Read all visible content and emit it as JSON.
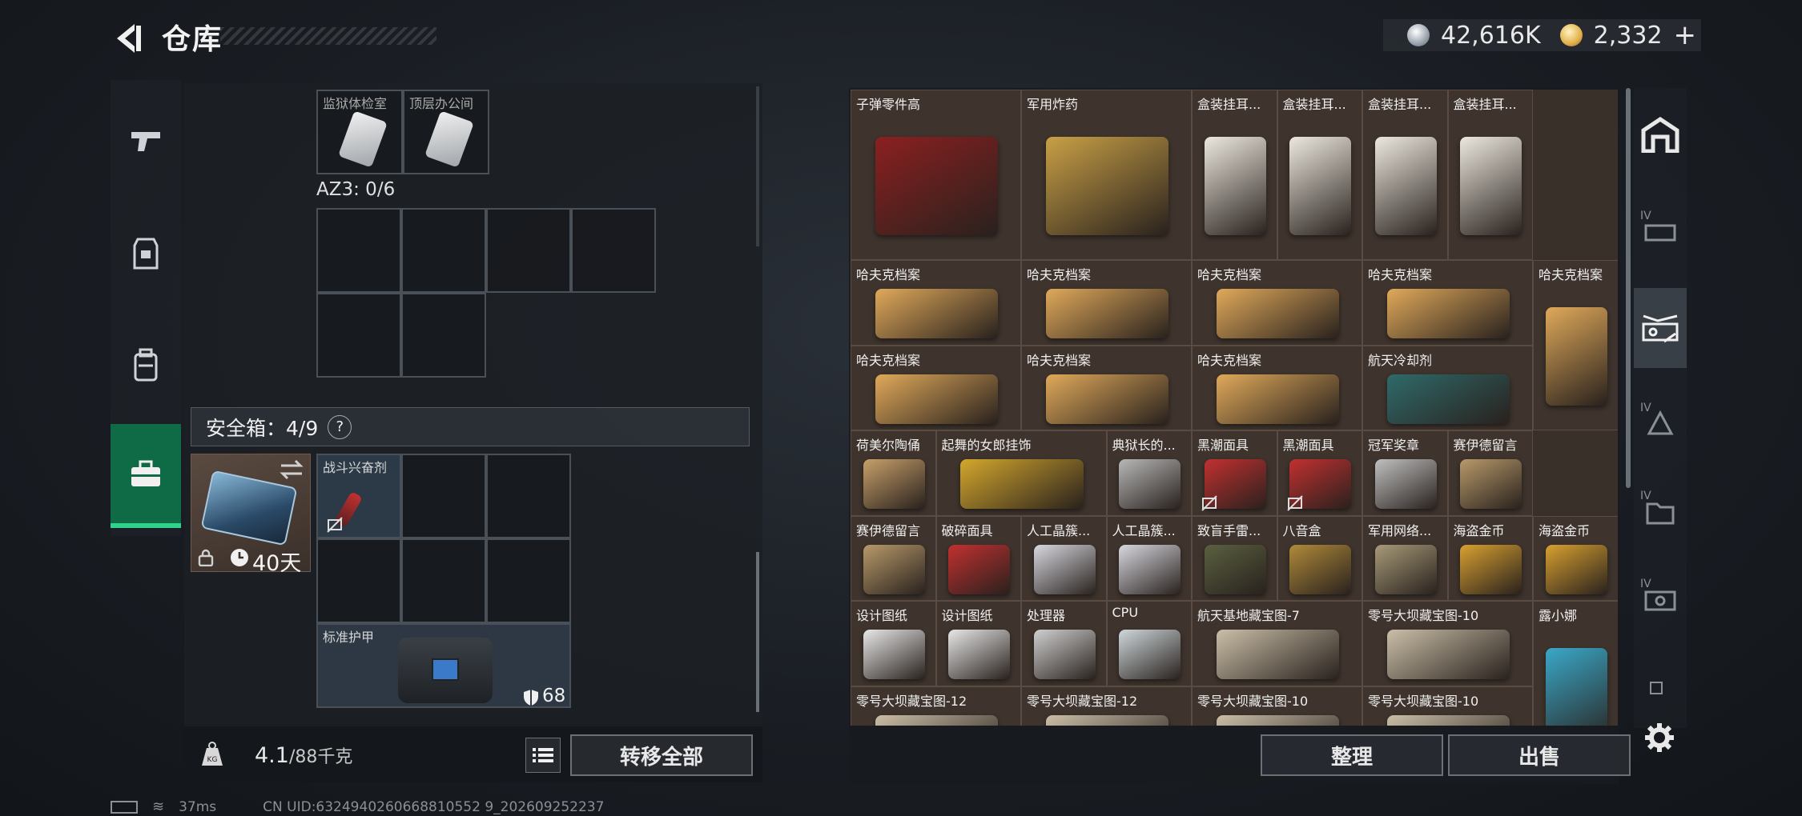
{
  "header": {
    "title": "仓库"
  },
  "currency": {
    "silver": "42,616K",
    "gold": "2,332",
    "plus": "+"
  },
  "left": {
    "top_cells": [
      "监狱体检室",
      "顶层办公间"
    ],
    "az3": "AZ3: 0/6",
    "safe_box_label": "安全箱：4/9",
    "safe_box_help": "?",
    "safe_box_time": "40天",
    "items": {
      "stim": "战斗兴奋剂",
      "armor": "标准护甲",
      "armor_value": "68"
    },
    "weight": "4.1",
    "weight_max": "/88千克",
    "weight_tag": "KG",
    "transfer_all": "转移全部"
  },
  "storage": {
    "items": [
      {
        "name": "子弹零件高",
        "color": "#8b2020"
      },
      {
        "name": "军用炸药",
        "color": "#c9a046"
      },
      {
        "name": "盒装挂耳...",
        "color": "#ede8df"
      },
      {
        "name": "盒装挂耳...",
        "color": "#ede8df"
      },
      {
        "name": "盒装挂耳...",
        "color": "#ede8df"
      },
      {
        "name": "盒装挂耳...",
        "color": "#ede8df"
      },
      {
        "name": "哈夫克档案",
        "color": "#e0a95a"
      },
      {
        "name": "哈夫克档案",
        "color": "#e0a95a"
      },
      {
        "name": "哈夫克档案",
        "color": "#e0a95a"
      },
      {
        "name": "哈夫克档案",
        "color": "#e0a95a"
      },
      {
        "name": "哈夫克档案",
        "color": "#e0a95a"
      },
      {
        "name": "哈夫克档案",
        "color": "#e0a95a"
      },
      {
        "name": "哈夫克档案",
        "color": "#e0a95a"
      },
      {
        "name": "哈夫克档案",
        "color": "#e0a95a"
      },
      {
        "name": "航天冷却剂",
        "color": "#2f6a6a"
      },
      {
        "name": "荷美尔陶俑",
        "color": "#c8a06a"
      },
      {
        "name": "起舞的女郎挂饰",
        "color": "#d4a72c"
      },
      {
        "name": "典狱长的...",
        "color": "#b8b8b8"
      },
      {
        "name": "黑潮面具",
        "color": "#c23030"
      },
      {
        "name": "黑潮面具",
        "color": "#c23030"
      },
      {
        "name": "冠军奖章",
        "color": "#c0c0c0"
      },
      {
        "name": "赛伊德留言",
        "color": "#b89a6a"
      },
      {
        "name": "赛伊德留言",
        "color": "#b89a6a"
      },
      {
        "name": "破碎面具",
        "color": "#c23030"
      },
      {
        "name": "人工晶簇...",
        "color": "#d8d8e0"
      },
      {
        "name": "人工晶簇...",
        "color": "#d8d8e0"
      },
      {
        "name": "致盲手雷...",
        "color": "#5a6040"
      },
      {
        "name": "八音盒",
        "color": "#b08a3a"
      },
      {
        "name": "军用网络...",
        "color": "#a89a78"
      },
      {
        "name": "海盗金币",
        "color": "#d8a030"
      },
      {
        "name": "海盗金币",
        "color": "#d8a030"
      },
      {
        "name": "设计图纸",
        "color": "#e8e8e8"
      },
      {
        "name": "设计图纸",
        "color": "#e8e8e8"
      },
      {
        "name": "处理器",
        "color": "#d0d0d0"
      },
      {
        "name": "CPU",
        "color": "#cfd8dc"
      },
      {
        "name": "航天基地藏宝图-7",
        "color": "#cbbfa8"
      },
      {
        "name": "零号大坝藏宝图-10",
        "color": "#cbbfa8"
      },
      {
        "name": "露小娜",
        "color": "#3aa8c8"
      },
      {
        "name": "零号大坝藏宝图-12",
        "color": "#cbbfa8"
      },
      {
        "name": "零号大坝藏宝图-12",
        "color": "#cbbfa8"
      },
      {
        "name": "零号大坝藏宝图-10",
        "color": "#cbbfa8"
      },
      {
        "name": "零号大坝藏宝图-10",
        "color": "#cbbfa8"
      }
    ]
  },
  "actions": {
    "sort": "整理",
    "sell": "出售"
  },
  "right_tabs": [
    "IV",
    "IV",
    "IV",
    "IV"
  ],
  "status": {
    "ping": "37ms",
    "uid": "CN UID:6324940260668810552 9_202609252237"
  }
}
